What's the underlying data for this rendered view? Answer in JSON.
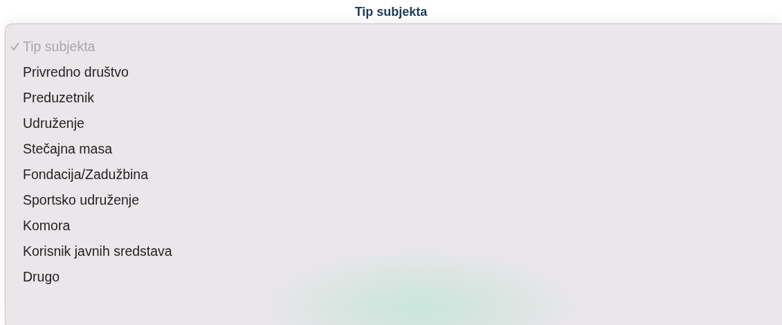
{
  "field_label": "Tip subjekta",
  "menu": {
    "items": [
      {
        "label": "Tip subjekta",
        "selected": true,
        "disabled": true
      },
      {
        "label": "Privredno društvo",
        "selected": false,
        "disabled": false
      },
      {
        "label": "Preduzetnik",
        "selected": false,
        "disabled": false
      },
      {
        "label": "Udruženje",
        "selected": false,
        "disabled": false
      },
      {
        "label": "Stečajna masa",
        "selected": false,
        "disabled": false
      },
      {
        "label": "Fondacija/Zadužbina",
        "selected": false,
        "disabled": false
      },
      {
        "label": "Sportsko udruženje",
        "selected": false,
        "disabled": false
      },
      {
        "label": "Komora",
        "selected": false,
        "disabled": false
      },
      {
        "label": "Korisnik javnih sredstava",
        "selected": false,
        "disabled": false
      },
      {
        "label": "Drugo",
        "selected": false,
        "disabled": false
      }
    ]
  }
}
